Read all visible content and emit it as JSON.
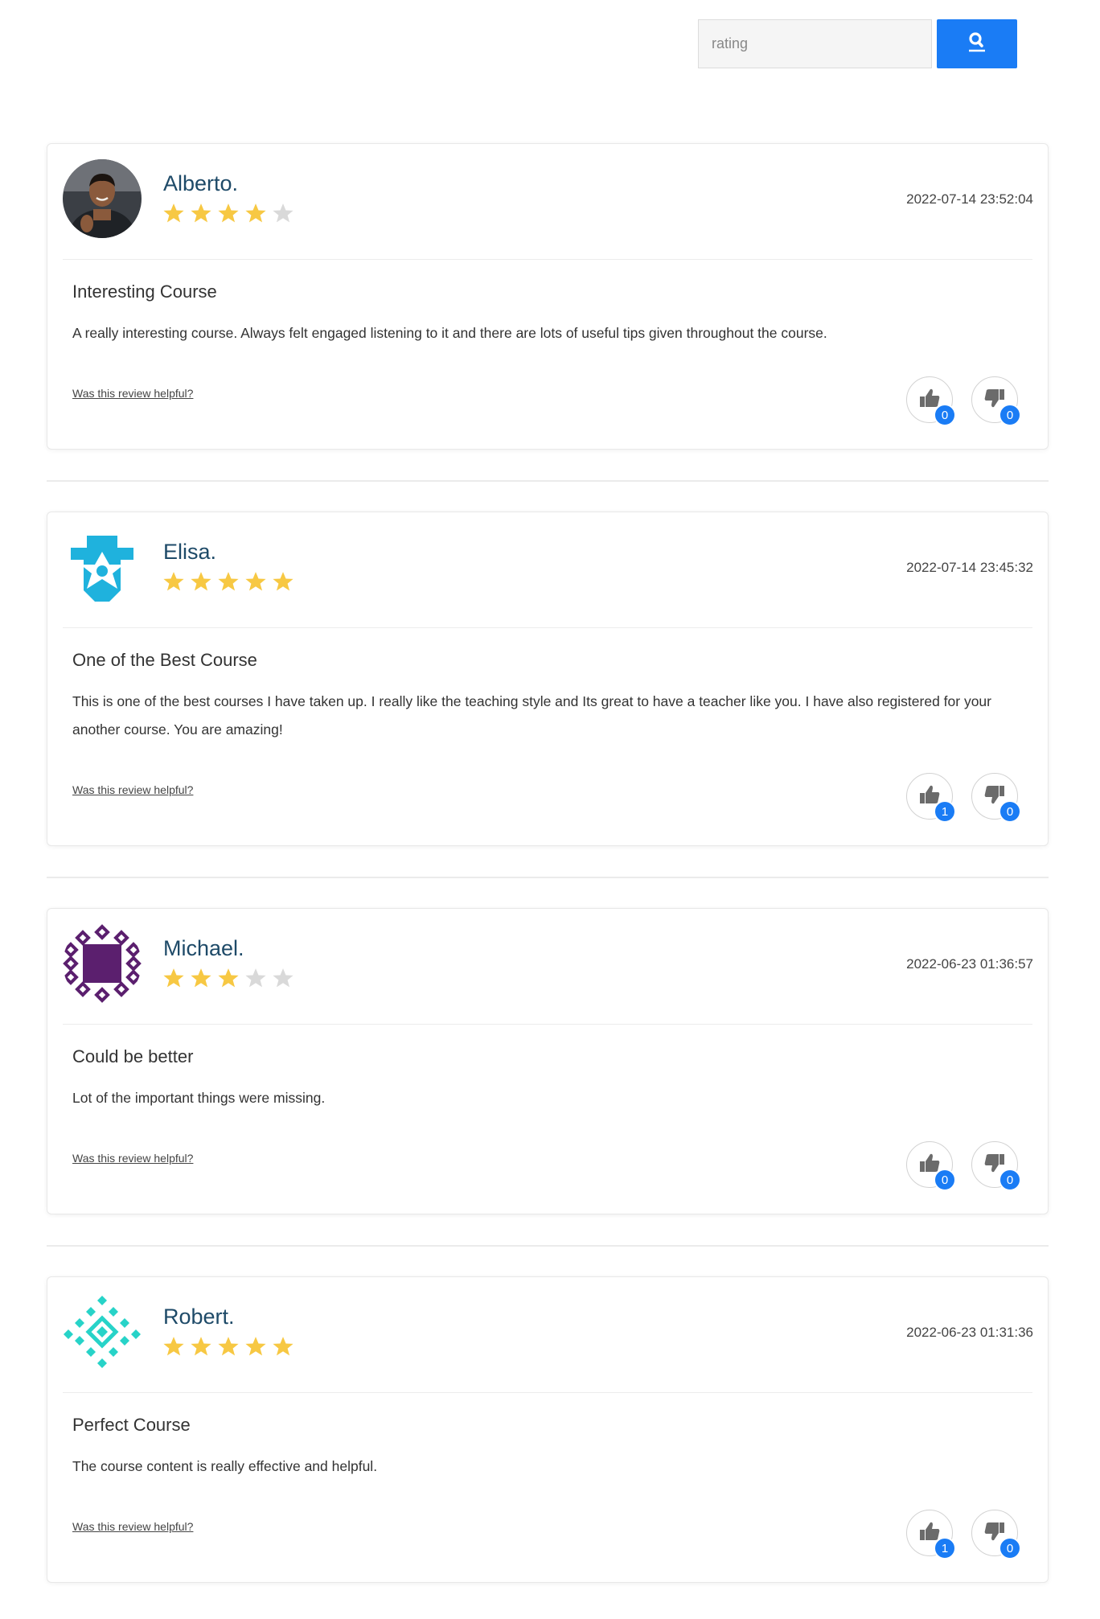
{
  "search": {
    "placeholder": "rating",
    "button_icon": "search-icon"
  },
  "colors": {
    "accent": "#1a7cf5",
    "name": "#1e4a68",
    "star_on": "#f7c843",
    "star_off": "#d9d9d9"
  },
  "reviews": [
    {
      "name": "Alberto.",
      "rating": 4,
      "date": "2022-07-14 23:52:04",
      "title": "Interesting Course",
      "body": "A really interesting course. Always felt engaged listening to it and there are lots of useful tips given throughout the course.",
      "helpful_label": "Was this review helpful?",
      "likes": "0",
      "dislikes": "0",
      "avatar": "photo"
    },
    {
      "name": "Elisa.",
      "rating": 5,
      "date": "2022-07-14 23:45:32",
      "title": "One of the Best Course",
      "body": "This is one of the best courses I have taken up. I really like the teaching style and Its great to have a teacher like you. I have also registered for your another course. You are amazing!",
      "helpful_label": "Was this review helpful?",
      "likes": "1",
      "dislikes": "0",
      "avatar": "cyan-pattern"
    },
    {
      "name": "Michael.",
      "rating": 3,
      "date": "2022-06-23 01:36:57",
      "title": "Could be better",
      "body": "Lot of the important things were missing.",
      "helpful_label": "Was this review helpful?",
      "likes": "0",
      "dislikes": "0",
      "avatar": "purple-pattern"
    },
    {
      "name": "Robert.",
      "rating": 5,
      "date": "2022-06-23 01:31:36",
      "title": "Perfect Course",
      "body": "The course content is really effective and helpful.",
      "helpful_label": "Was this review helpful?",
      "likes": "1",
      "dislikes": "0",
      "avatar": "teal-pattern"
    }
  ]
}
